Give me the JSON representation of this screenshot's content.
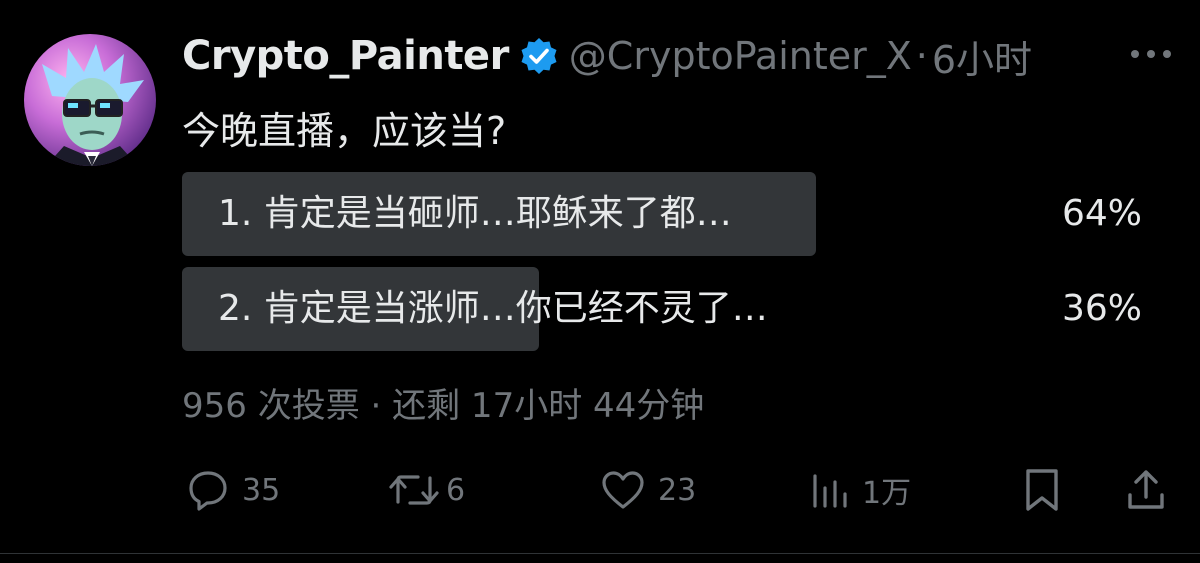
{
  "author": {
    "display_name": "Crypto_Painter",
    "handle": "@CryptoPainter_X",
    "separator": "·",
    "time": "6小时",
    "verified": true
  },
  "tweet": {
    "text": "今晚直播，应该当?"
  },
  "poll": {
    "options": [
      {
        "label": "1. 肯定是当砸师…耶稣来了都…",
        "percent": "64%",
        "fraction": 0.64
      },
      {
        "label": "2. 肯定是当涨师…你已经不灵了…",
        "percent": "36%",
        "fraction": 0.36
      }
    ],
    "meta": "956 次投票 · 还剩 17小时 44分钟"
  },
  "actions": {
    "reply_count": "35",
    "retweet_count": "6",
    "like_count": "23",
    "views_count": "1万"
  },
  "colors": {
    "background": "#000000",
    "text": "#e7e9ea",
    "secondary": "#71767b",
    "poll_bar": "#333639",
    "verified_badge": "#1d9bf0"
  },
  "icons": {
    "reply": "reply-icon",
    "retweet": "retweet-icon",
    "like": "heart-icon",
    "views": "views-chart-icon",
    "bookmark": "bookmark-icon",
    "share": "share-icon",
    "more": "more-dots-icon",
    "verified": "verified-badge-icon"
  }
}
